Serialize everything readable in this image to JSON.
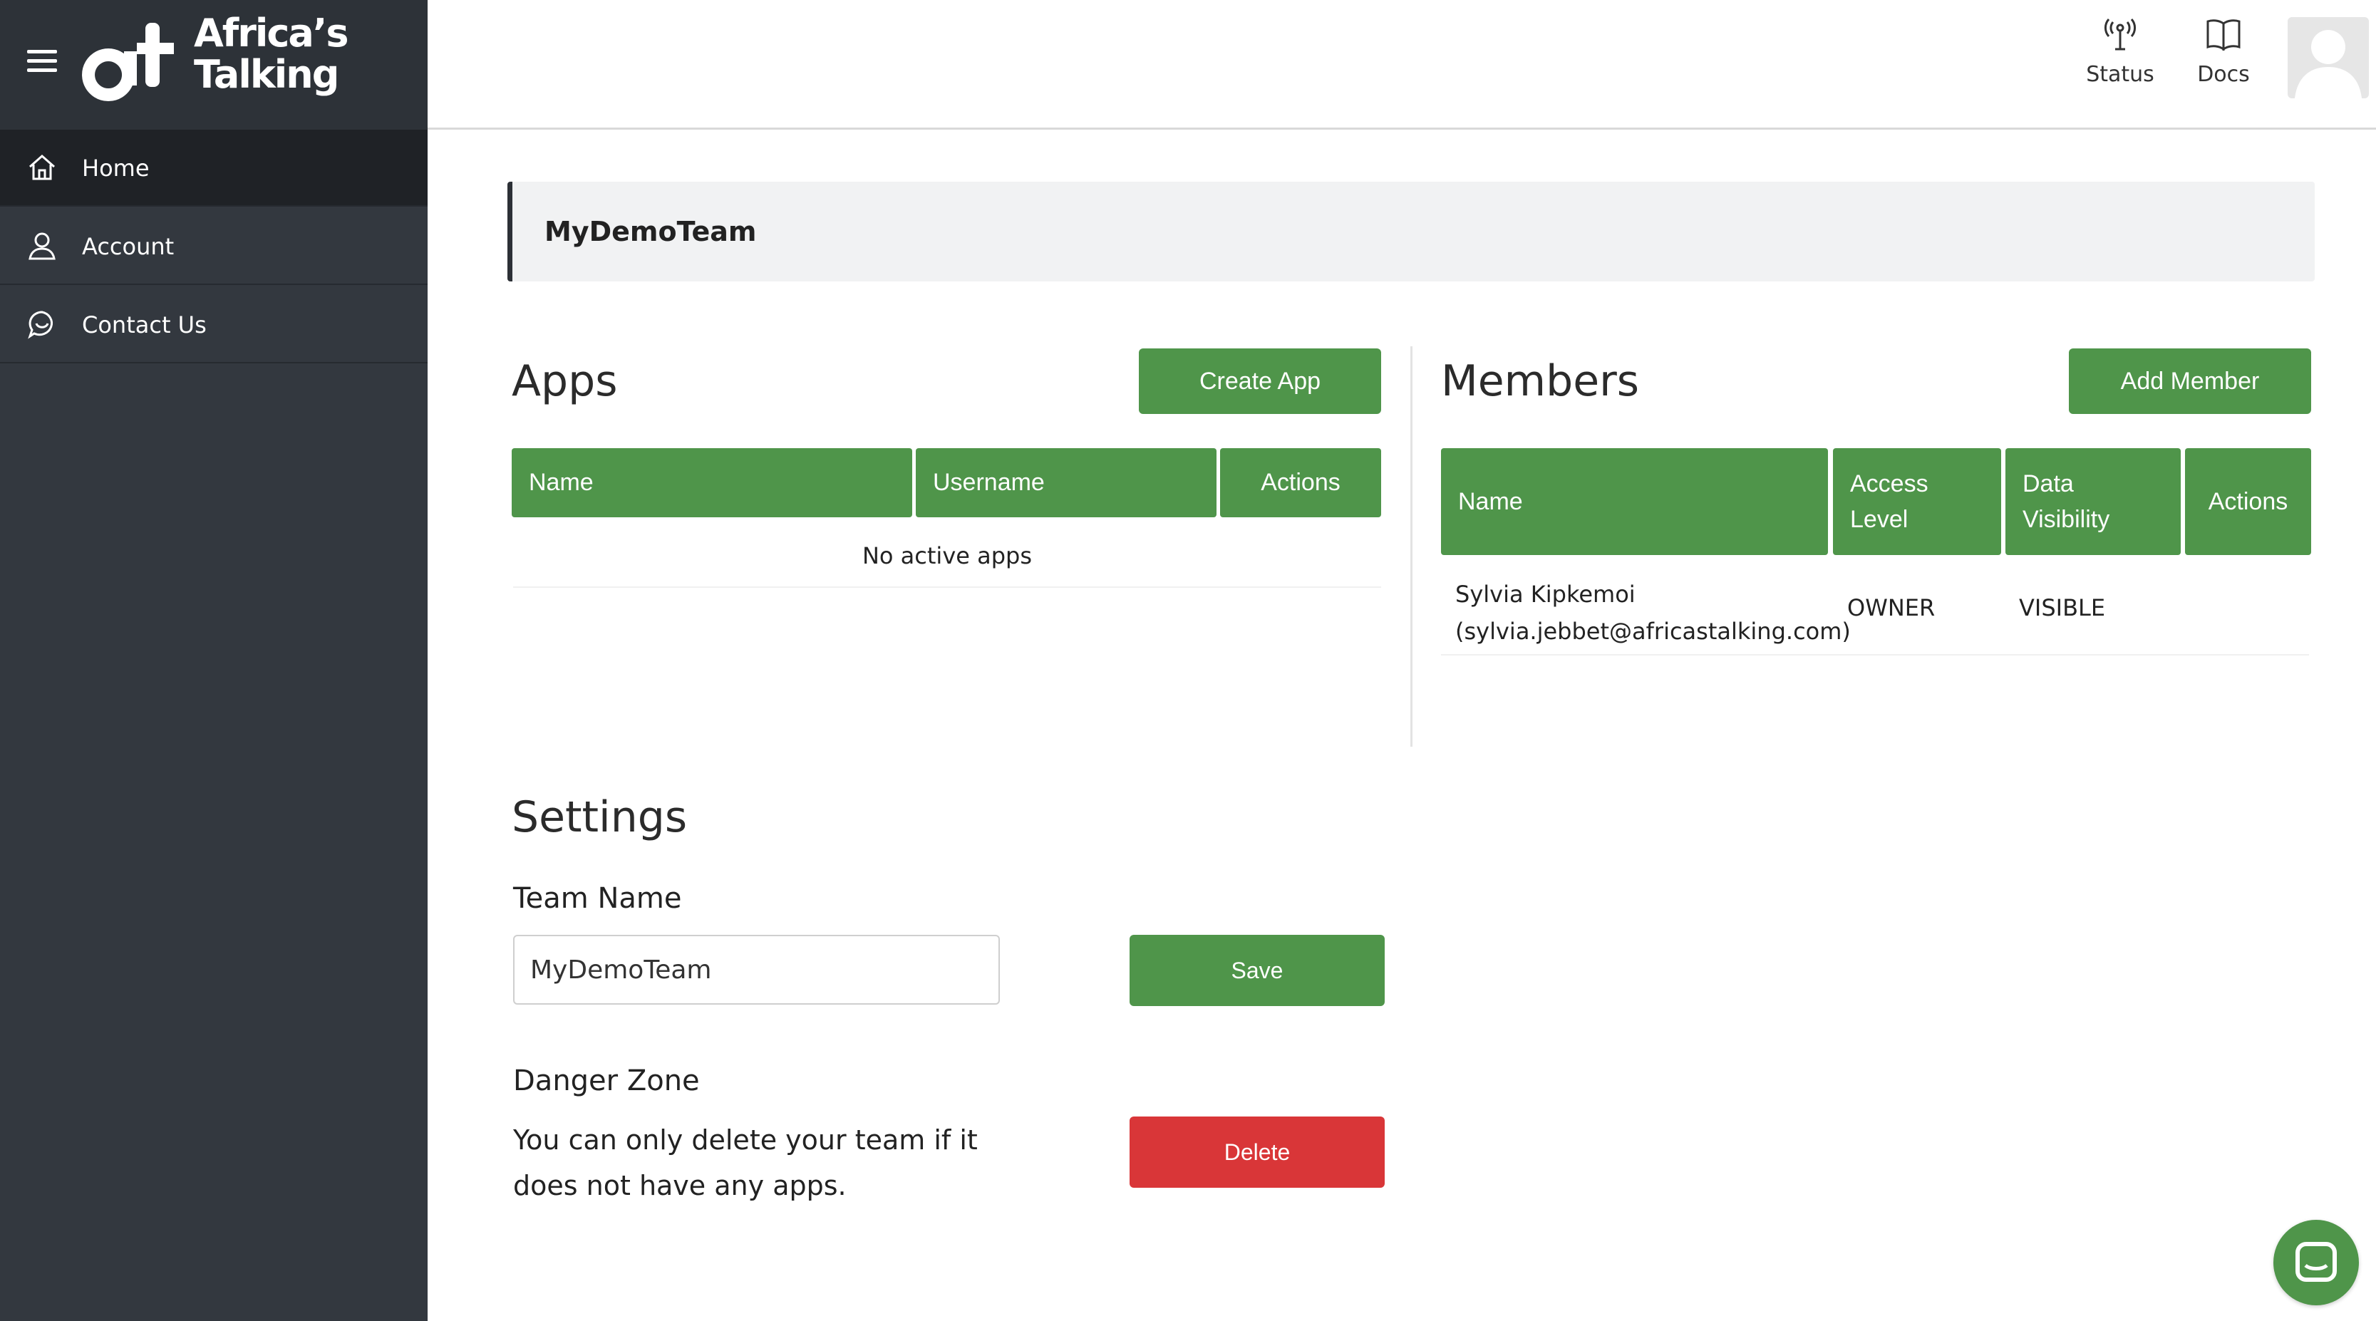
{
  "brand": {
    "logo_lines": [
      "Africa’s",
      "Talking"
    ]
  },
  "sidebar": {
    "items": [
      {
        "label": "Home",
        "icon": "home-icon"
      },
      {
        "label": "Account",
        "icon": "user-icon"
      },
      {
        "label": "Contact Us",
        "icon": "chat-icon"
      }
    ]
  },
  "header": {
    "status_label": "Status",
    "docs_label": "Docs"
  },
  "team": {
    "name": "MyDemoTeam"
  },
  "apps": {
    "title": "Apps",
    "create_label": "Create App",
    "columns": [
      "Name",
      "Username",
      "Actions"
    ],
    "empty_text": "No active apps"
  },
  "members": {
    "title": "Members",
    "add_label": "Add Member",
    "columns": [
      "Name",
      "Access Level",
      "Data Visibility",
      "Actions"
    ],
    "rows": [
      {
        "name": "Sylvia Kipkemoi",
        "email": "(sylvia.jebbet@africastalking.com)",
        "access_level": "OWNER",
        "visibility": "VISIBLE"
      }
    ]
  },
  "settings": {
    "title": "Settings",
    "team_name_label": "Team Name",
    "team_name_value": "MyDemoTeam",
    "save_label": "Save",
    "danger_title": "Danger Zone",
    "danger_text": "You can only delete your team if it does not have any apps.",
    "delete_label": "Delete"
  },
  "colors": {
    "sidebar": "#33383f",
    "accent_green": "#4f954a",
    "danger_red": "#d93638"
  }
}
